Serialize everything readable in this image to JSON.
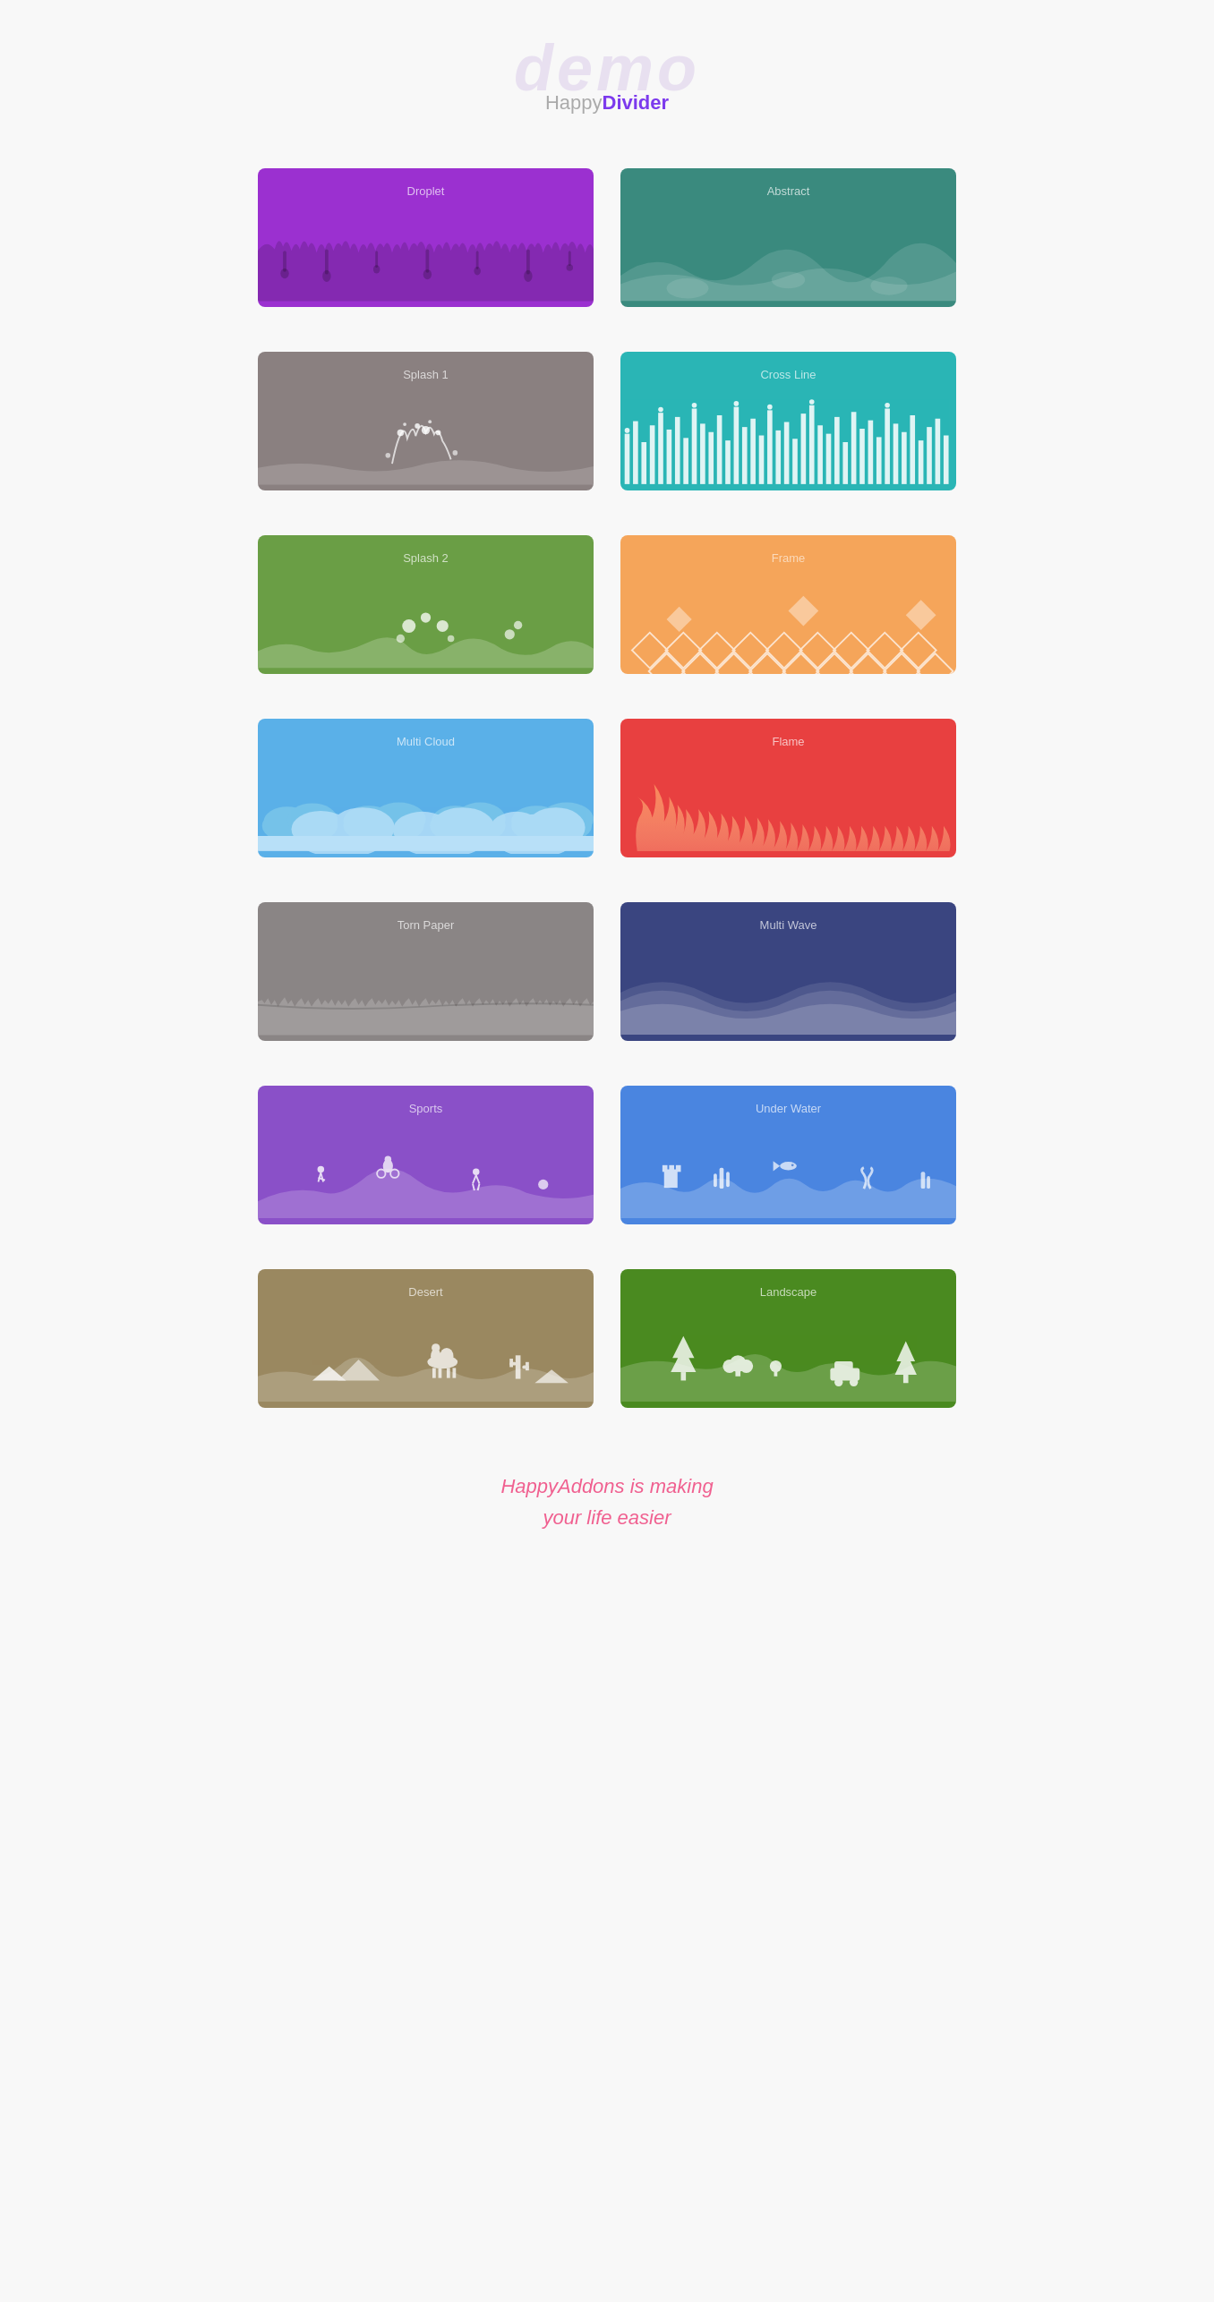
{
  "header": {
    "demo_label": "demo",
    "happy_label": "Happy",
    "divider_label": "Divider"
  },
  "cards": [
    {
      "id": "droplet",
      "label": "Droplet",
      "class": "card-droplet"
    },
    {
      "id": "abstract",
      "label": "Abstract",
      "class": "card-abstract"
    },
    {
      "id": "splash1",
      "label": "Splash 1",
      "class": "card-splash1"
    },
    {
      "id": "crossline",
      "label": "Cross Line",
      "class": "card-crossline"
    },
    {
      "id": "splash2",
      "label": "Splash 2",
      "class": "card-splash2"
    },
    {
      "id": "frame",
      "label": "Frame",
      "class": "card-frame"
    },
    {
      "id": "multicloud",
      "label": "Multi Cloud",
      "class": "card-multicloud"
    },
    {
      "id": "flame",
      "label": "Flame",
      "class": "card-flame"
    },
    {
      "id": "tornpaper",
      "label": "Torn Paper",
      "class": "card-tornpaper"
    },
    {
      "id": "multiwave",
      "label": "Multi Wave",
      "class": "card-multiwave"
    },
    {
      "id": "sports",
      "label": "Sports",
      "class": "card-sports"
    },
    {
      "id": "underwater",
      "label": "Under Water",
      "class": "card-underwater"
    },
    {
      "id": "desert",
      "label": "Desert",
      "class": "card-desert"
    },
    {
      "id": "landscape",
      "label": "Landscape",
      "class": "card-landscape"
    }
  ],
  "footer": {
    "line1": "HappyAddons is making",
    "line2": "your life easier"
  }
}
